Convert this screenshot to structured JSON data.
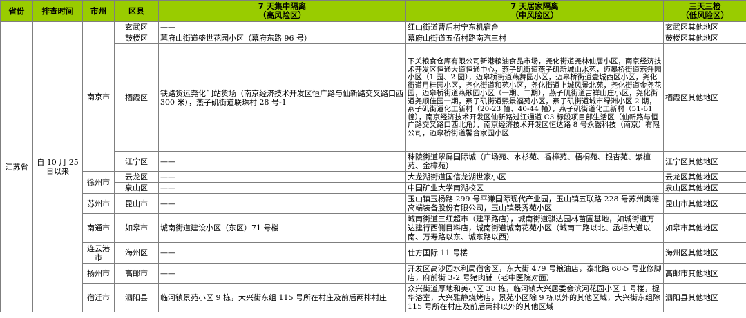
{
  "header": {
    "province": "省份",
    "screen_time": "排查时间",
    "city": "市州",
    "district": "区县",
    "col_high_title": "7 天集中隔离",
    "col_high_sub": "（高风险区）",
    "col_mid_title": "7 天居家隔离",
    "col_mid_sub": "（中风险区）",
    "col_low_title": "三天三检",
    "col_low_sub": "（低风险区）"
  },
  "province": "江苏省",
  "screen_time": "自 10 月 25 日以来",
  "rows": [
    {
      "city": "南京市",
      "district": "玄武区",
      "high": "——",
      "mid": "红山街道曹后村宁东机宿舍",
      "low": "玄武区其他地区"
    },
    {
      "district": "鼓楼区",
      "high": "幕府山街道盛世花园小区（幕府东路 96 号）",
      "mid": "幕府山街道五佰村路南汽三村",
      "low": "鼓楼区其他地区"
    },
    {
      "district": "栖霞区",
      "high": "铁路货运尧化门站货场（南京经济技术开发区恒广路与仙新路交叉路口西 300 米），燕子矶街道联珠村 28 号-1",
      "mid": "下关粮食仓库有限公司新港粮油食品市场，尧化街道尧林仙居小区，南京经济技术开发区恒通大道恒通中心，燕子矶街道燕子矶新城山水苑，迈皋桥街道燕升园小区（1 园、2 园），迈皋桥街道燕舞园小区，迈皋桥街道壹城西区小区，尧化街道月桂园小区，尧化街道和苑小区，尧化街道上城风景北苑，尧化街道金尧花园，迈皋桥街道燕歌园小区（一期、二期），燕子矶街道吉祥山庄小区，尧化街道尧顺佳园一期，燕子矶街道熙景福苑小区，燕子矶街道城市绿洲小区 2 期，燕子矶街道化工新村（20-23 幢、40-44 幢），燕子矶街道化工新村（51-61 幢），南京经济技术开发区仙新路过江通道 C3 标段项目部生活区（仙新路与恒广路交叉路口西北角），南京经济技术开发区恒达路 8 号永锴科技（南京）有限公司，迈皋桥街道馨合家园小区",
      "low": "栖霞区其他地区"
    },
    {
      "district": "江宁区",
      "high": "——",
      "mid": "秣陵街道翠屏国际城（广场苑、水杉苑、香樟苑、梧桐苑、银杏苑、紫檀苑、金樟苑）",
      "low": "江宁区其他地区"
    },
    {
      "city": "徐州市",
      "district": "云龙区",
      "high": "——",
      "mid": "大龙湖街道国信龙湖世家小区",
      "low": "云龙区其他地区"
    },
    {
      "district": "泉山区",
      "high": "——",
      "mid": "中国矿业大学南湖校区",
      "low": "泉山区其他地区"
    },
    {
      "city": "苏州市",
      "district": "昆山市",
      "high": "——",
      "mid": "玉山镇玉杨路 299 号平谦国际现代产业园，玉山镇五联路 228 号苏州奥德高端装备股份有限公司，玉山镇景秀苑小区",
      "low": "昆山市其他地区"
    },
    {
      "city": "南通市",
      "district": "如皋市",
      "high": "城南街道建设小区（东区）71 号楼",
      "mid": "城南街道三红超市（建平路店），城南街道骐达园林苗圃基地，如城街道万达建行西侧目料店，城南街道城南花苑小区（城南二路以北、丞相大道以南、万寿路以东、城东路以西）",
      "low": "如皋市其他地区"
    },
    {
      "city": "连云港市",
      "district": "海州区",
      "high": "——",
      "mid": "仕方国际 11 号楼",
      "low": "海州区其他地区"
    },
    {
      "city": "扬州市",
      "district": "高邮市",
      "high": "——",
      "mid": "开发区高沙园水利局宿舍区，东大街 479 号粮油店，泰北路 68-5 号业修脚店，府前街 3-2 号猪肉铺（老中医院对面）",
      "low": "高邮市其他地区"
    },
    {
      "city": "宿迁市",
      "district": "泗阳县",
      "high": "临河镇景苑小区 9 栋，大兴街东组 115 号所在村庄及前后两排村庄",
      "mid": "众兴街道厚地和美小区 38 栋，临河镇大兴居委会滨河花园小区 1 号楼，捉华浴室，大兴雅静烧烤店，景苑小区除 9 栋以外的其他区域，大兴街东组除 115 号所在村庄及前后两排以外的其他区域",
      "low": "泗阳县其他地区"
    }
  ],
  "colors": {
    "header_bg": "#99cc00",
    "border": "#7f7f7f"
  }
}
